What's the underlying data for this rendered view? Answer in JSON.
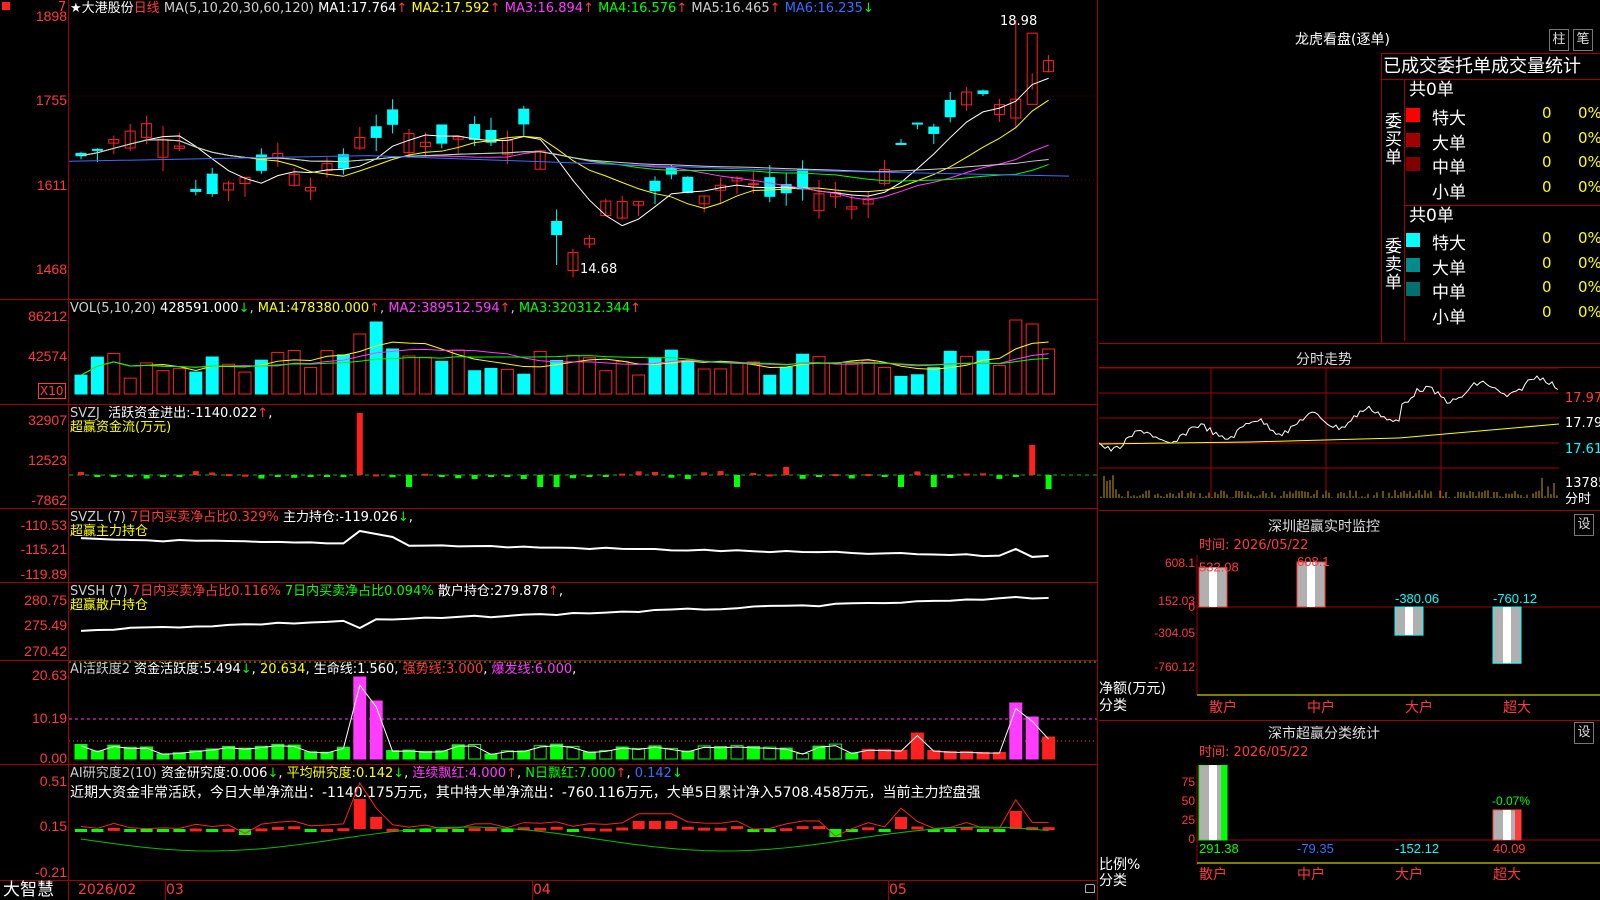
{
  "stock": {
    "name": "★大港股份",
    "period": "日线",
    "marker": "7"
  },
  "colors": {
    "up": "#ff2020",
    "down": "#00ffff",
    "grid": "#a00000",
    "ma1": "#ffffff",
    "ma2": "#ffff00",
    "ma3": "#ff3cff",
    "ma4": "#00ff00",
    "ma5": "#cfcfcf",
    "ma6": "#3c6cff"
  },
  "main_chart": {
    "ma_label": "MA(5,10,20,30,60,120)",
    "ma_values": [
      {
        "label": "MA1:",
        "value": "17.764",
        "arrow": "↑"
      },
      {
        "label": "MA2:",
        "value": "17.592",
        "arrow": "↑"
      },
      {
        "label": "MA3:",
        "value": "16.894",
        "arrow": "↑"
      },
      {
        "label": "MA4:",
        "value": "16.576",
        "arrow": "↑"
      },
      {
        "label": "MA5:",
        "value": "16.465",
        "arrow": "↑"
      },
      {
        "label": "MA6:",
        "value": "16.235",
        "arrow": "↓"
      }
    ],
    "y_ticks": [
      "1898",
      "1755",
      "1611",
      "1468"
    ],
    "high_mark": "18.98",
    "low_mark": "14.68"
  },
  "volume": {
    "label": "VOL(5,10,20)",
    "value": "428591.000",
    "value_arrow": "↓",
    "ma": [
      {
        "label": "MA1:",
        "value": "478380.000",
        "arrow": "↑"
      },
      {
        "label": "MA2:",
        "value": "389512.594",
        "arrow": "↑"
      },
      {
        "label": "MA3:",
        "value": "320312.344",
        "arrow": "↑"
      }
    ],
    "y_ticks": [
      "86212",
      "42574"
    ],
    "unit": "X10"
  },
  "svzj": {
    "label": "SVZJ",
    "text": "活跃资金进出:",
    "value": "-1140.022",
    "arrow": "↑",
    "suffix": ",",
    "subtitle": "超赢资金流(万元)",
    "y_ticks": [
      "32907",
      "12523",
      "-7862"
    ]
  },
  "svzl": {
    "label": "SVZL (7)",
    "t1": "7日内买卖净占比0.329%",
    "t2": "主力持仓:",
    "value": "-119.026",
    "arrow": "↓",
    "suffix": ",",
    "subtitle": "超赢主力持仓",
    "y_ticks": [
      "-110.53",
      "-115.21",
      "-119.89"
    ]
  },
  "svsh": {
    "label": "SVSH (7)",
    "t1": "7日内买卖净占比0.116%",
    "t2": "7日内买卖净占比0.094%",
    "t3": "散户持仓:",
    "value": "279.878",
    "arrow": "↑",
    "suffix": ",",
    "subtitle": "超赢散户持仓",
    "y_ticks": [
      "280.75",
      "275.49",
      "270.42"
    ]
  },
  "ai_active": {
    "label": "AI活跃度2",
    "t1": "资金活跃度:",
    "v1": "5.494",
    "a1": "↓",
    "v2": "20.634",
    "t3": "生命线:",
    "v3": "1.560",
    "t4": "强势线:",
    "v4": "3.000",
    "t5": "爆发线:",
    "v5": "6.000",
    "sep": ",",
    "y_ticks": [
      "20.63",
      "10.19",
      "0.00"
    ]
  },
  "ai_research": {
    "label": "AI研究度2(10)",
    "t1": "资金研究度:",
    "v1": "0.006",
    "a1": "↓",
    "t2": "平均研究度:",
    "v2": "0.142",
    "a2": "↓",
    "t3": "连续飘红:",
    "v3": "4.000",
    "a3": "↑",
    "t4": "N日飘红:",
    "v4": "7.000",
    "a4": "↑",
    "v5": "0.142",
    "a5": "↓",
    "sep": ",",
    "comment": "近期大资金非常活跃，今日大单净流出：-1140.175万元，其中特大单净流出：-760.116万元，大单5日累计净入5708.458万元，当前主力控盘强",
    "y_ticks": [
      "0.51",
      "0.15",
      "-0.21"
    ]
  },
  "time_axis": {
    "labels": [
      "2026/02",
      "03",
      "04",
      "05"
    ],
    "brand": "大智慧"
  },
  "dragon_panel": {
    "title": "龙虎看盘(逐单)",
    "btn1": "柱",
    "btn2": "笔",
    "header": "已成交委托单成交量统计",
    "buy": {
      "side": "委买单",
      "total": "共0单",
      "rows": [
        {
          "name": "特大",
          "count": "0",
          "pct": "0%",
          "color": "#ff0000"
        },
        {
          "name": "大单",
          "count": "0",
          "pct": "0%",
          "color": "#a00000"
        },
        {
          "name": "中单",
          "count": "0",
          "pct": "0%",
          "color": "#800000"
        },
        {
          "name": "小单",
          "count": "0",
          "pct": "0%",
          "color": ""
        }
      ]
    },
    "sell": {
      "side": "委卖单",
      "total": "共0单",
      "rows": [
        {
          "name": "特大",
          "count": "0",
          "pct": "0%",
          "color": "#00ffff"
        },
        {
          "name": "大单",
          "count": "0",
          "pct": "0%",
          "color": "#008c8c"
        },
        {
          "name": "中单",
          "count": "0",
          "pct": "0%",
          "color": "#007070"
        },
        {
          "name": "小单",
          "count": "0",
          "pct": "0%",
          "color": ""
        }
      ]
    }
  },
  "intraday": {
    "title": "分时走势",
    "y_ticks": [
      "17.97",
      "17.79",
      "17.61",
      "13785"
    ],
    "vol_unit": "分时"
  },
  "sz_monitor": {
    "title": "深圳超赢实时监控",
    "btn": "设",
    "time": "时间: 2026/05/22",
    "y_ticks": [
      "608.1",
      "152.03",
      "0",
      "-304.05",
      "-760.12"
    ],
    "y_label": "净额(万元)",
    "x_label": "分类",
    "categories": [
      "散户",
      "中户",
      "大户",
      "超大"
    ],
    "values": [
      532.08,
      608.1,
      -380.06,
      -760.12
    ],
    "value_labels": [
      "532.08",
      "608.1",
      "-380.06",
      "-760.12"
    ]
  },
  "sz_classify": {
    "title": "深市超赢分类统计",
    "btn": "设",
    "time": "时间: 2026/05/22",
    "y_ticks": [
      "75",
      "50",
      "25",
      "0"
    ],
    "y_label": "比例%",
    "x_label": "分类",
    "categories": [
      "散户",
      "中户",
      "大户",
      "超大"
    ],
    "values": [
      291.38,
      -79.35,
      -152.12,
      40.09
    ],
    "value_labels": [
      "291.38",
      "-79.35",
      "-152.12",
      "40.09"
    ],
    "extra_label": "-0.07%"
  }
}
